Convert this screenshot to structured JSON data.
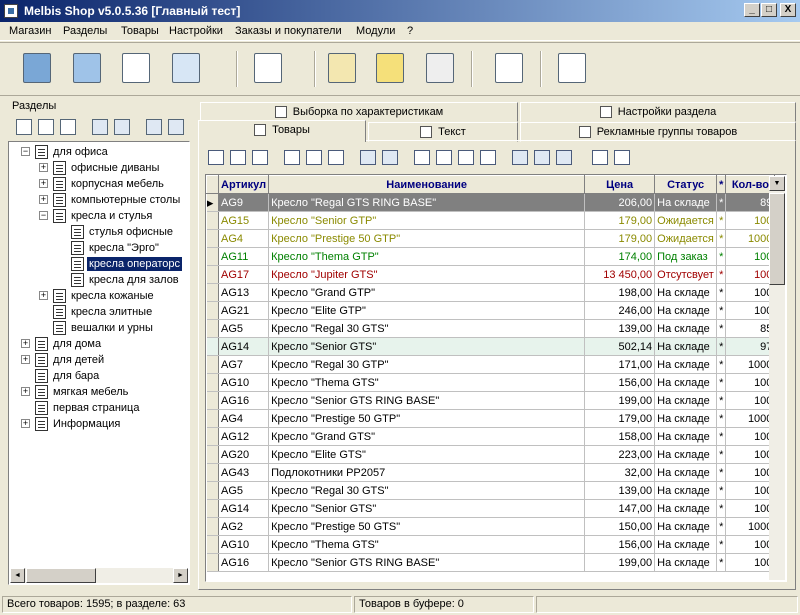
{
  "window": {
    "title": "Melbis Shop v5.0.5.36 [Главный тест]",
    "min": "_",
    "max": "□",
    "close": "X"
  },
  "menu": [
    "Магазин",
    "Разделы",
    "Товары",
    "Настройки",
    "Заказы и покупатели",
    "Модули",
    "?"
  ],
  "toolbar_icons": [
    "modules-cube-icon",
    "user-card-icon",
    "transfer-icon",
    "database-icon",
    "window-star-icon",
    "docs-stack-icon",
    "list-yellow-icon",
    "percent-docs-icon",
    "checklist-icon",
    "basket-window-icon"
  ],
  "left": {
    "header": "Разделы"
  },
  "tree": [
    {
      "label": "для офиса",
      "level": 0,
      "expand": "-"
    },
    {
      "label": "офисные диваны",
      "level": 1,
      "expand": "+"
    },
    {
      "label": "корпусная мебель",
      "level": 1,
      "expand": "+"
    },
    {
      "label": "компьютерные столы",
      "level": 1,
      "expand": "+"
    },
    {
      "label": "кресла и стулья",
      "level": 1,
      "expand": "-"
    },
    {
      "label": "стулья офисные",
      "level": 2,
      "expand": ""
    },
    {
      "label": "кресла \"Эрго\"",
      "level": 2,
      "expand": ""
    },
    {
      "label": "кресла операторс",
      "level": 2,
      "expand": "",
      "selected": true
    },
    {
      "label": "кресла для залов",
      "level": 2,
      "expand": ""
    },
    {
      "label": "кресла кожаные",
      "level": 1,
      "expand": "+"
    },
    {
      "label": "кресла элитные",
      "level": 1,
      "expand": ""
    },
    {
      "label": "вешалки и урны",
      "level": 1,
      "expand": ""
    },
    {
      "label": "для дома",
      "level": 0,
      "expand": "+"
    },
    {
      "label": "для детей",
      "level": 0,
      "expand": "+"
    },
    {
      "label": "для бара",
      "level": 0,
      "expand": ""
    },
    {
      "label": "мягкая мебель",
      "level": 0,
      "expand": "+"
    },
    {
      "label": "первая страница",
      "level": 0,
      "expand": "",
      "home": true
    },
    {
      "label": "Информация",
      "level": 0,
      "expand": "+"
    }
  ],
  "tabs": {
    "top": [
      "Выборка по характеристикам",
      "Настройки раздела"
    ],
    "bottom": [
      "Товары",
      "Текст",
      "Рекламные группы товаров"
    ]
  },
  "grid": {
    "columns": [
      "Артикул",
      "Наименование",
      "Цена",
      "Статус",
      "*",
      "Кол-во"
    ],
    "rows": [
      {
        "sku": "AG9",
        "name": "Кресло \"Regal GTS RING BASE\"",
        "price": "206,00",
        "status": "На складе",
        "star": "*",
        "qty": "89",
        "style": "sel"
      },
      {
        "sku": "AG15",
        "name": "Кресло \"Senior GTP\"",
        "price": "179,00",
        "status": "Ожидается",
        "star": "*",
        "qty": "100",
        "style": "c-y"
      },
      {
        "sku": "AG4",
        "name": "Кресло \"Prestige 50 GTP\"",
        "price": "179,00",
        "status": "Ожидается",
        "star": "*",
        "qty": "1000",
        "style": "c-y"
      },
      {
        "sku": "AG11",
        "name": "Кресло \"Thema GTP\"",
        "price": "174,00",
        "status": "Под заказ",
        "star": "*",
        "qty": "100",
        "style": "c-g"
      },
      {
        "sku": "AG17",
        "name": "Кресло \"Jupiter GTS\"",
        "price": "13 450,00",
        "status": "Отсутсвует",
        "star": "*",
        "qty": "100",
        "style": "c-r"
      },
      {
        "sku": "AG13",
        "name": "Кресло \"Grand GTP\"",
        "price": "198,00",
        "status": "На складе",
        "star": "*",
        "qty": "100",
        "style": ""
      },
      {
        "sku": "AG21",
        "name": "Кресло \"Elite GTP\"",
        "price": "246,00",
        "status": "На складе",
        "star": "*",
        "qty": "100",
        "style": ""
      },
      {
        "sku": "AG5",
        "name": "Кресло \"Regal 30 GTS\"",
        "price": "139,00",
        "status": "На складе",
        "star": "*",
        "qty": "85",
        "style": ""
      },
      {
        "sku": "AG14",
        "name": "Кресло \"Senior GTS\"",
        "price": "502,14",
        "status": "На складе",
        "star": "*",
        "qty": "97",
        "style": "hi"
      },
      {
        "sku": "AG7",
        "name": "Кресло \"Regal 30 GTP\"",
        "price": "171,00",
        "status": "На складе",
        "star": "*",
        "qty": "1000",
        "style": ""
      },
      {
        "sku": "AG10",
        "name": "Кресло \"Thema GTS\"",
        "price": "156,00",
        "status": "На складе",
        "star": "*",
        "qty": "100",
        "style": ""
      },
      {
        "sku": "AG16",
        "name": "Кресло \"Senior GTS RING BASE\"",
        "price": "199,00",
        "status": "На складе",
        "star": "*",
        "qty": "100",
        "style": ""
      },
      {
        "sku": "AG4",
        "name": "Кресло \"Prestige 50 GTP\"",
        "price": "179,00",
        "status": "На складе",
        "star": "*",
        "qty": "1000",
        "style": ""
      },
      {
        "sku": "AG12",
        "name": "Кресло \"Grand GTS\"",
        "price": "158,00",
        "status": "На складе",
        "star": "*",
        "qty": "100",
        "style": ""
      },
      {
        "sku": "AG20",
        "name": "Кресло \"Elite GTS\"",
        "price": "223,00",
        "status": "На складе",
        "star": "*",
        "qty": "100",
        "style": ""
      },
      {
        "sku": "AG43",
        "name": "Подлокотники PP2057",
        "price": "32,00",
        "status": "На складе",
        "star": "*",
        "qty": "100",
        "style": ""
      },
      {
        "sku": "AG5",
        "name": "Кресло \"Regal 30 GTS\"",
        "price": "139,00",
        "status": "На складе",
        "star": "*",
        "qty": "100",
        "style": ""
      },
      {
        "sku": "AG14",
        "name": "Кресло \"Senior GTS\"",
        "price": "147,00",
        "status": "На складе",
        "star": "*",
        "qty": "100",
        "style": ""
      },
      {
        "sku": "AG2",
        "name": "Кресло \"Prestige 50 GTS\"",
        "price": "150,00",
        "status": "На складе",
        "star": "*",
        "qty": "1000",
        "style": ""
      },
      {
        "sku": "AG10",
        "name": "Кресло \"Thema GTS\"",
        "price": "156,00",
        "status": "На складе",
        "star": "*",
        "qty": "100",
        "style": ""
      },
      {
        "sku": "AG16",
        "name": "Кресло \"Senior GTS RING BASE\"",
        "price": "199,00",
        "status": "На складе",
        "star": "*",
        "qty": "100",
        "style": ""
      }
    ]
  },
  "status": {
    "total": "Всего товаров: 1595; в разделе: 63",
    "buffer": "Товаров в буфере: 0"
  }
}
